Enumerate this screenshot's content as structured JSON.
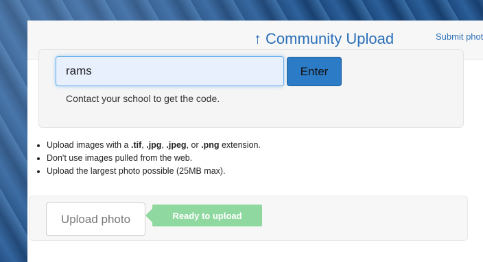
{
  "header": {
    "title": "Community Upload",
    "title_icon": "upload-arrow-icon",
    "submit_link": "Submit photos"
  },
  "code_entry": {
    "value": "rams",
    "enter_label": "Enter",
    "hint": "Contact your school to get the code."
  },
  "rules": [
    {
      "text_parts": [
        "Upload images with a ",
        ".tif",
        ", ",
        ".jpg",
        ", ",
        ".jpeg",
        ", or ",
        ".png",
        " extension."
      ]
    },
    {
      "text": "Don't use images pulled from the web."
    },
    {
      "text": "Upload the largest photo possible (25MB max)."
    }
  ],
  "upload": {
    "button_label": "Upload photo",
    "status": "Ready to upload"
  },
  "colors": {
    "accent": "#2a6fb8",
    "status": "#8fd8a0"
  }
}
